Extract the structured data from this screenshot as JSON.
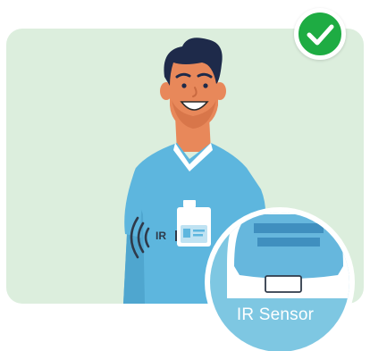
{
  "illustration": {
    "ir_signal_label": "IR",
    "sensor_label": "IR Sensor",
    "status": "approved",
    "colors": {
      "background_card": "#dceedd",
      "shirt": "#5db6de",
      "skin": "#e8885a",
      "hair": "#1e2a4a",
      "sensor_circle": "#7ec7e2",
      "check_badge": "#1eac43"
    }
  }
}
